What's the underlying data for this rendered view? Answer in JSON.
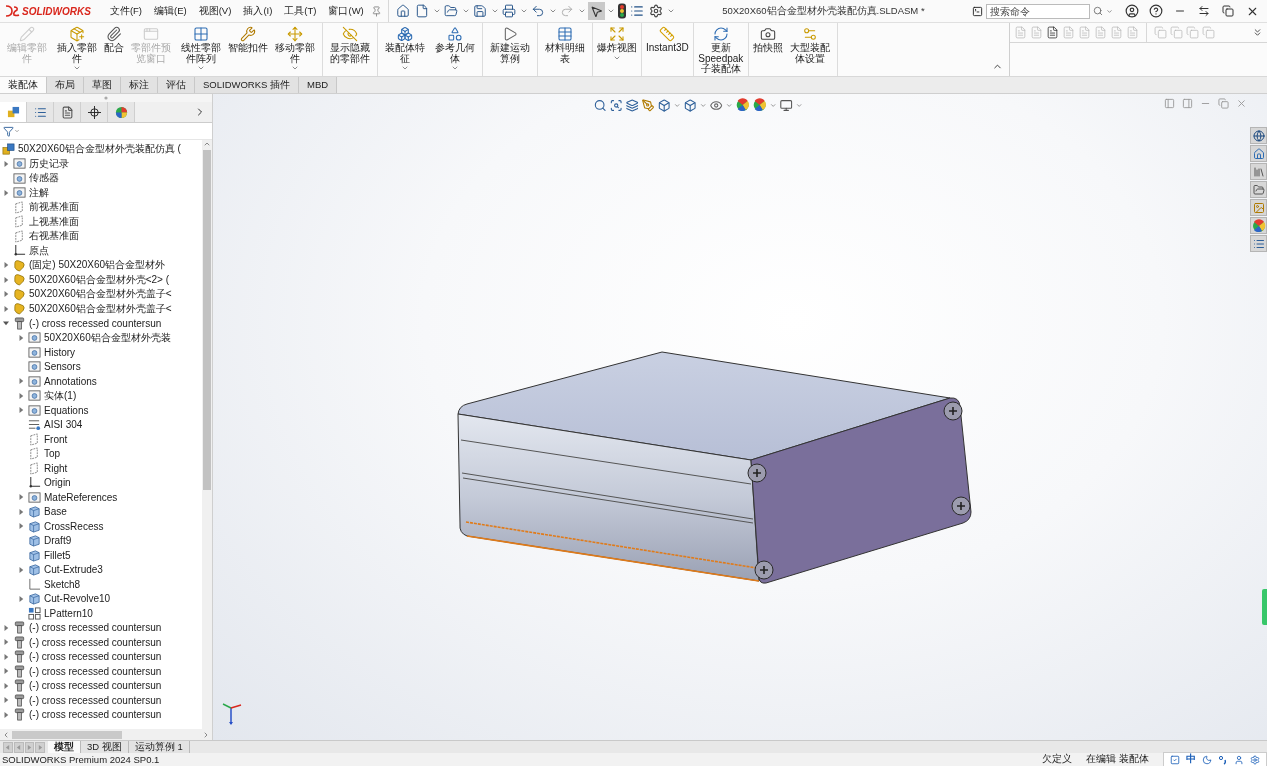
{
  "app": {
    "name": "SOLIDWORKS"
  },
  "menu": [
    "文件(F)",
    "编辑(E)",
    "视图(V)",
    "插入(I)",
    "工具(T)",
    "窗口(W)"
  ],
  "quick_toolbar": {
    "select_active": true
  },
  "window": {
    "title": "50X20X60铝合金型材外壳装配仿真.SLDASM *"
  },
  "search": {
    "placeholder": "搜索命令"
  },
  "command_groups": [
    [
      {
        "label": "编辑零部件",
        "disabled": true,
        "dropdown": false
      },
      {
        "label": "插入零部件",
        "disabled": false,
        "dropdown": true
      },
      {
        "label": "配合",
        "disabled": false,
        "dropdown": false
      },
      {
        "label": "零部件预览窗口",
        "disabled": true,
        "dropdown": false
      },
      {
        "label": "线性零部件阵列",
        "disabled": false,
        "dropdown": true
      },
      {
        "label": "智能扣件",
        "disabled": false,
        "dropdown": false
      },
      {
        "label": "移动零部件",
        "disabled": false,
        "dropdown": true
      }
    ],
    [
      {
        "label": "显示隐藏的零部件",
        "disabled": false,
        "dropdown": false
      }
    ],
    [
      {
        "label": "装配体特征",
        "disabled": false,
        "dropdown": true
      },
      {
        "label": "参考几何体",
        "disabled": false,
        "dropdown": true
      }
    ],
    [
      {
        "label": "新建运动算例",
        "disabled": false,
        "dropdown": false
      }
    ],
    [
      {
        "label": "材料明细表",
        "disabled": false,
        "dropdown": false
      }
    ],
    [
      {
        "label": "爆炸视图",
        "disabled": false,
        "dropdown": true
      }
    ],
    [
      {
        "label": "Instant3D",
        "disabled": false,
        "dropdown": false
      }
    ],
    [
      {
        "label": "更新Speedpak子装配体",
        "disabled": false,
        "dropdown": false
      }
    ],
    [
      {
        "label": "拍快照",
        "disabled": false,
        "dropdown": false
      },
      {
        "label": "大型装配体设置",
        "disabled": false,
        "dropdown": false
      }
    ]
  ],
  "ribbon_tabs": [
    {
      "label": "装配体",
      "selected": true
    },
    {
      "label": "布局",
      "selected": false
    },
    {
      "label": "草图",
      "selected": false
    },
    {
      "label": "标注",
      "selected": false
    },
    {
      "label": "评估",
      "selected": false
    },
    {
      "label": "SOLIDWORKS 插件",
      "selected": false
    },
    {
      "label": "MBD",
      "selected": false
    }
  ],
  "panel_tabs": [
    {
      "kind": "features",
      "selected": true
    },
    {
      "kind": "properties",
      "selected": false
    },
    {
      "kind": "configurations",
      "selected": false
    },
    {
      "kind": "dimxpert",
      "selected": false
    },
    {
      "kind": "display",
      "selected": false
    }
  ],
  "feature_tree": {
    "label": "50X20X60铝合金型材外壳装配仿真 (",
    "kind": "assembly",
    "children": [
      {
        "label": "历史记录",
        "kind": "folder",
        "expanded": false
      },
      {
        "label": "传感器",
        "kind": "folder"
      },
      {
        "label": "注解",
        "kind": "folder",
        "expanded": false
      },
      {
        "label": "前视基准面",
        "kind": "plane"
      },
      {
        "label": "上视基准面",
        "kind": "plane"
      },
      {
        "label": "右视基准面",
        "kind": "plane"
      },
      {
        "label": "原点",
        "kind": "origin"
      },
      {
        "label": "(固定) 50X20X60铝合金型材外",
        "kind": "part",
        "expanded": false
      },
      {
        "label": "50X20X60铝合金型材外壳<2> (",
        "kind": "part",
        "expanded": false
      },
      {
        "label": "50X20X60铝合金型材外壳盖子<",
        "kind": "part",
        "expanded": false
      },
      {
        "label": "50X20X60铝合金型材外壳盖子<",
        "kind": "part",
        "expanded": false
      },
      {
        "label": "(-) cross recessed countersun",
        "kind": "screw",
        "expanded": true,
        "children": [
          {
            "label": "50X20X60铝合金型材外壳装",
            "kind": "folder",
            "expanded": false
          },
          {
            "label": "History",
            "kind": "folder"
          },
          {
            "label": "Sensors",
            "kind": "folder"
          },
          {
            "label": "Annotations",
            "kind": "folder",
            "expanded": false
          },
          {
            "label": "实体(1)",
            "kind": "folder",
            "expanded": false
          },
          {
            "label": "Equations",
            "kind": "folder",
            "expanded": false
          },
          {
            "label": "AISI 304",
            "kind": "material"
          },
          {
            "label": "Front",
            "kind": "plane"
          },
          {
            "label": "Top",
            "kind": "plane"
          },
          {
            "label": "Right",
            "kind": "plane"
          },
          {
            "label": "Origin",
            "kind": "origin"
          },
          {
            "label": "MateReferences",
            "kind": "folder",
            "expanded": false
          },
          {
            "label": "Base",
            "kind": "feature",
            "expanded": false
          },
          {
            "label": "CrossRecess",
            "kind": "feature",
            "expanded": false
          },
          {
            "label": "Draft9",
            "kind": "feature"
          },
          {
            "label": "Fillet5",
            "kind": "feature"
          },
          {
            "label": "Cut-Extrude3",
            "kind": "feature",
            "expanded": false
          },
          {
            "label": "Sketch8",
            "kind": "sketch"
          },
          {
            "label": "Cut-Revolve10",
            "kind": "feature",
            "expanded": false
          },
          {
            "label": "LPattern10",
            "kind": "pattern"
          }
        ]
      },
      {
        "label": "(-) cross recessed countersun",
        "kind": "screw",
        "expanded": false
      },
      {
        "label": "(-) cross recessed countersun",
        "kind": "screw",
        "expanded": false
      },
      {
        "label": "(-) cross recessed countersun",
        "kind": "screw",
        "expanded": false
      },
      {
        "label": "(-) cross recessed countersun",
        "kind": "screw",
        "expanded": false
      },
      {
        "label": "(-) cross recessed countersun",
        "kind": "screw",
        "expanded": false
      },
      {
        "label": "(-) cross recessed countersun",
        "kind": "screw",
        "expanded": false
      },
      {
        "label": "(-) cross recessed countersun",
        "kind": "screw",
        "expanded": false
      }
    ]
  },
  "bottom_tabs": [
    {
      "label": "模型",
      "selected": true
    },
    {
      "label": "3D 视图",
      "selected": false
    },
    {
      "label": "运动算例 1",
      "selected": false
    }
  ],
  "status_bar": {
    "product": "SOLIDWORKS Premium 2024 SP0.1",
    "state": "欠定义",
    "mode": "在编辑 装配体",
    "ime": "中"
  }
}
